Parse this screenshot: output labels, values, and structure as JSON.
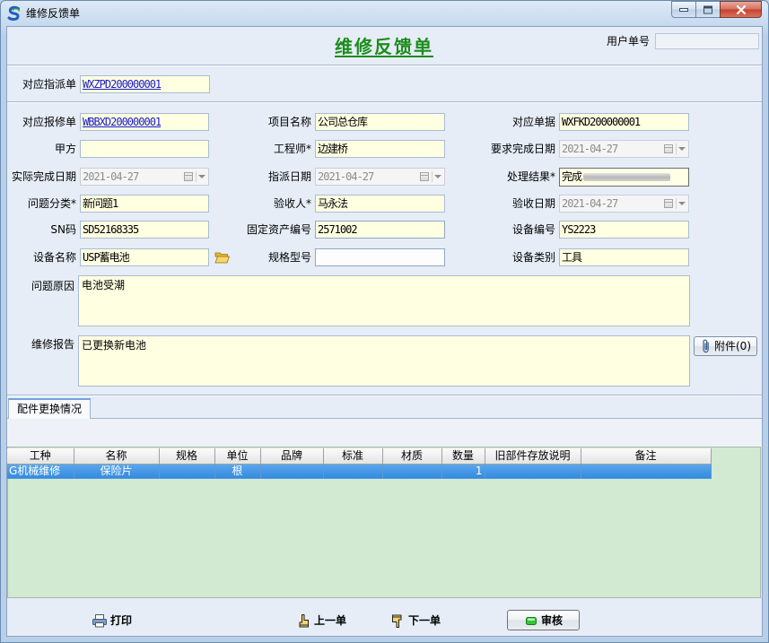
{
  "window": {
    "title": "维修反馈单",
    "icon": "app-logo-icon",
    "controls": [
      "minimize-icon",
      "maximize-icon",
      "close-icon"
    ]
  },
  "header": {
    "title": "维修反馈单",
    "user_no_label": "用户单号",
    "user_no_value": ""
  },
  "dispatch": {
    "label": "对应指派单",
    "value": "WXZPD200000001"
  },
  "fields": {
    "repair_order": {
      "label": "对应报修单",
      "value": "WBBXD200000001"
    },
    "project_name": {
      "label": "项目名称",
      "value": "公司总仓库"
    },
    "ref_doc": {
      "label": "对应单据",
      "value": "WXFKD200000001"
    },
    "party_a": {
      "label": "甲方",
      "value": ""
    },
    "engineer": {
      "label": "工程师*",
      "value": "边建桥"
    },
    "required_date": {
      "label": "要求完成日期",
      "value": "2021-04-27"
    },
    "actual_date": {
      "label": "实际完成日期",
      "value": "2021-04-27"
    },
    "dispatch_date": {
      "label": "指派日期",
      "value": "2021-04-27"
    },
    "result": {
      "label": "处理结果*",
      "value": "完成"
    },
    "category": {
      "label": "问题分类*",
      "value": "新问题1"
    },
    "acceptor": {
      "label": "验收人*",
      "value": "马永法"
    },
    "accept_date": {
      "label": "验收日期",
      "value": "2021-04-27"
    },
    "sn": {
      "label": "SN码",
      "value": "SD52168335"
    },
    "asset_no": {
      "label": "固定资产编号",
      "value": "2571002"
    },
    "device_no": {
      "label": "设备编号",
      "value": "YS2223"
    },
    "device_name": {
      "label": "设备名称",
      "value": "USP蓄电池"
    },
    "spec_model": {
      "label": "规格型号",
      "value": ""
    },
    "device_type": {
      "label": "设备类别",
      "value": "工具"
    },
    "problem_cause": {
      "label": "问题原因",
      "value": "电池受潮"
    },
    "repair_report": {
      "label": "维修报告",
      "value": "已更换新电池"
    }
  },
  "attachment": {
    "label": "附件(0)",
    "icon": "paperclip-icon"
  },
  "tabs": [
    {
      "label": "配件更换情况",
      "active": true
    }
  ],
  "parts_table": {
    "columns": [
      "工种",
      "名称",
      "规格",
      "单位",
      "品牌",
      "标准",
      "材质",
      "数量",
      "旧部件存放说明",
      "备注"
    ],
    "rows": [
      [
        "G机械维修",
        "保险片",
        "",
        "根",
        "",
        "",
        "",
        "1",
        "",
        ""
      ]
    ],
    "selected_row": 0
  },
  "footer": {
    "print": {
      "label": "打印",
      "icon": "printer-icon"
    },
    "prev": {
      "label": "上一单",
      "icon": "hand-up-icon"
    },
    "next": {
      "label": "下一单",
      "icon": "hand-down-icon"
    },
    "audit": {
      "label": "审核",
      "icon": "green-led-icon"
    }
  },
  "colors": {
    "title_green": "#1b8d1b",
    "field_bg": "#ffffe1",
    "link": "#1a1ad0",
    "grid_bg": "#d2e9d2",
    "selected_row": "#3a8fe2",
    "close_button": "#c5402e"
  }
}
